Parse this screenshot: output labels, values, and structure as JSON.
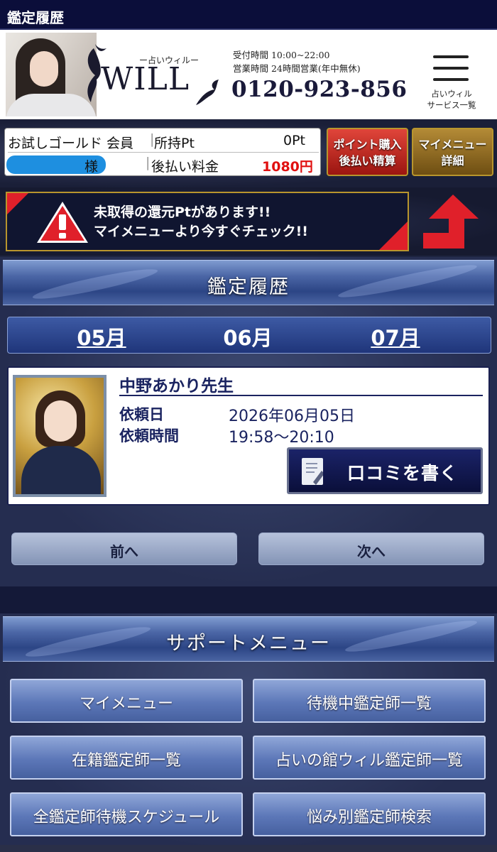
{
  "window": {
    "title": "鑑定履歴"
  },
  "header": {
    "logo_sub": "ー占いウィルー",
    "logo_word": "WILL",
    "hours_line1": "受付時間 10:00~22:00",
    "hours_line2": "営業時間 24時間営業(年中無休)",
    "phone": "0120-923-856",
    "menu_label_line1": "占いウィル",
    "menu_label_line2": "サービス一覧"
  },
  "member": {
    "rank": "お試しゴールド 会員",
    "points_label": "所持Pt",
    "points_value": "0Pt",
    "name_suffix": "様",
    "deferred_label": "後払い料金",
    "deferred_value": "1080円"
  },
  "actions": {
    "points_line1": "ポイント購入",
    "points_line2": "後払い精算",
    "mymenu_line1": "マイメニュー",
    "mymenu_line2": "詳細"
  },
  "alert": {
    "line1": "未取得の還元Ptがあります!!",
    "line2": "マイメニューより今すぐチェック!!"
  },
  "history": {
    "section_title": "鑑定履歴",
    "months": [
      "05月",
      "06月",
      "07月"
    ],
    "fortune_teller": "中野あかり先生",
    "date_label": "依頼日",
    "date_value": "2026年06月05日",
    "time_label": "依頼時間",
    "time_value": "19:58～20:10",
    "review_button": "口コミを書く",
    "prev_button": "前へ",
    "next_button": "次へ"
  },
  "support": {
    "section_title": "サポートメニュー",
    "items": [
      "マイメニュー",
      "待機中鑑定師一覧",
      "在籍鑑定師一覧",
      "占いの館ウィル鑑定師一覧",
      "全鑑定師待機スケジュール",
      "悩み別鑑定師検索"
    ]
  },
  "colors": {
    "navy": "#0b0e3a",
    "alert_red": "#e0202a",
    "deferred_red": "#e01010",
    "gold": "#b8952d",
    "masked_name": "#1e8fe0"
  }
}
